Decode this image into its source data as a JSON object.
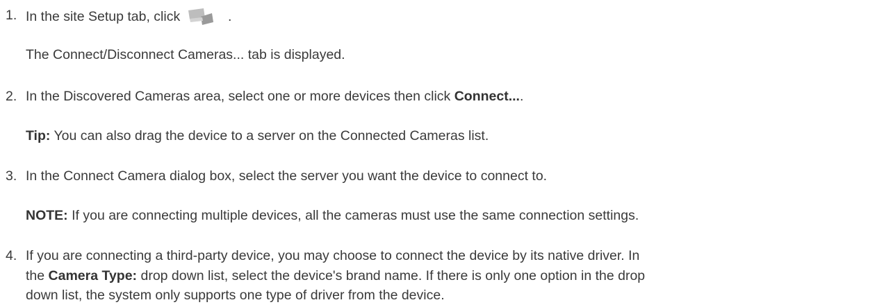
{
  "steps": [
    {
      "number": "1.",
      "text_before_icon": "In the site Setup tab, click",
      "text_after_icon": ".",
      "icon": "connect-cameras-icon",
      "result": "The Connect/Disconnect Cameras... tab is displayed."
    },
    {
      "number": "2.",
      "text": "In the Discovered Cameras area, select one or more devices then click ",
      "bold": "Connect...",
      "text_after": ".",
      "tip_label": "Tip:",
      "tip_text": " You can also drag the device to a server on the Connected Cameras list."
    },
    {
      "number": "3.",
      "text": "In the Connect Camera dialog box, select the server you want the device to connect to.",
      "note_label": "NOTE:",
      "note_text": " If you are connecting multiple devices, all the cameras must use the same connection settings."
    },
    {
      "number": "4.",
      "line1": "If you are connecting a third-party device, you may choose to connect the device by its native driver. In",
      "line2_before": "the ",
      "line2_bold": "Camera Type:",
      "line2_after": " drop down list, select the device's brand name. If there is only one option in the drop",
      "line3": "down list, the system only supports one type of driver from the device."
    }
  ]
}
